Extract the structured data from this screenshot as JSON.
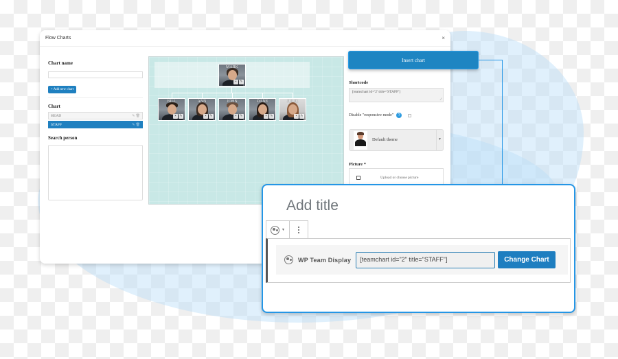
{
  "modal": {
    "title": "Flow Charts",
    "close_icon": "×"
  },
  "left_panel": {
    "chart_name_label": "Chart name",
    "chart_name_value": "",
    "add_button": "+ Add new chart",
    "chart_label": "Chart",
    "charts": [
      {
        "name": "HEAD",
        "active": false
      },
      {
        "name": "STAFF",
        "active": true
      }
    ],
    "chart_item_actions": "✎ 🗑",
    "search_label": "Search person"
  },
  "org_chart": {
    "root": {
      "name": "MARK"
    },
    "children": [
      {
        "name": "BILL"
      },
      {
        "name": "ANN"
      },
      {
        "name": "JOHN"
      },
      {
        "name": "DANE"
      },
      {
        "name": "JULIE"
      }
    ]
  },
  "right_panel": {
    "insert_button": "Insert chart",
    "shortcode_label": "Shortcode",
    "shortcode_value": "[teamchart id='2' title='STAFF']",
    "responsive_label": "Disable \"responsive mode\"",
    "help_icon": "?",
    "theme_selected": "Default theme",
    "picture_label": "Picture *",
    "picture_placeholder": "Upload or choose picture"
  },
  "editor": {
    "title_placeholder": "Add title",
    "block_name": "WP Team Display",
    "shortcode_value": "[teamchart id=\"2\" title=\"STAFF\"]",
    "change_button": "Change Chart",
    "accent_color": "#2496e6",
    "button_color": "#1e7ec0"
  }
}
